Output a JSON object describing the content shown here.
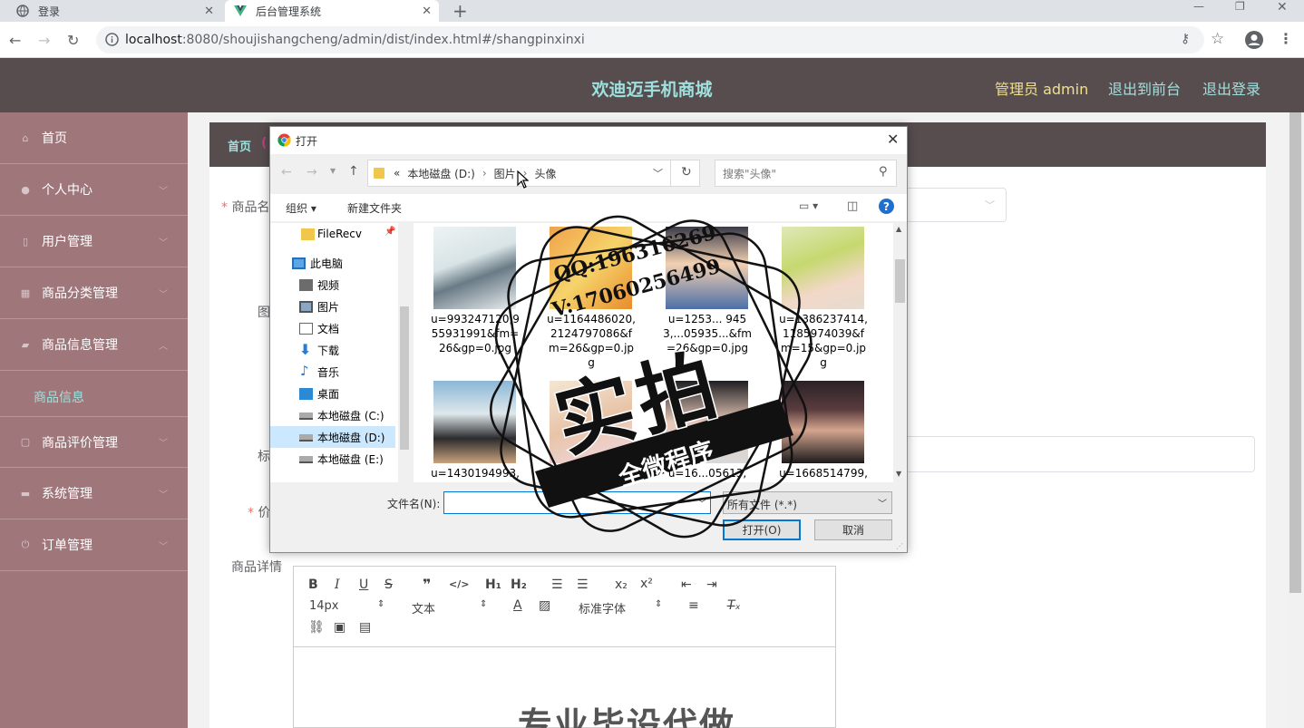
{
  "browser": {
    "tabs": [
      {
        "title": "登录",
        "active": false
      },
      {
        "title": "后台管理系统",
        "active": true
      }
    ],
    "new_tab": "+",
    "url_host": "localhost",
    "url_rest": ":8080/shoujishangcheng/admin/dist/index.html#/shangpinxinxi"
  },
  "app": {
    "title": "欢迪迈手机商城",
    "admin_label": "管理员 admin",
    "to_front": "退出到前台",
    "logout": "退出登录",
    "colors": {
      "header": "#574d4f",
      "sidebar": "#9f777b",
      "title": "#9fe0dd",
      "accent_link": "#f0e08b",
      "active_menu": "#9fe0dd"
    }
  },
  "sidebar": {
    "items": [
      {
        "label": "首页",
        "icon": "home-icon"
      },
      {
        "label": "个人中心",
        "icon": "user-icon"
      },
      {
        "label": "用户管理",
        "icon": "phone-icon"
      },
      {
        "label": "商品分类管理",
        "icon": "grid-icon"
      },
      {
        "label": "商品信息管理",
        "icon": "bag-icon"
      },
      {
        "label": "商品评价管理",
        "icon": "chat-icon"
      },
      {
        "label": "系统管理",
        "icon": "monitor-icon"
      },
      {
        "label": "订单管理",
        "icon": "power-icon"
      }
    ],
    "sub_item": "商品信息"
  },
  "breadcrumb": {
    "home": "首页",
    "paren": "("
  },
  "form": {
    "name_label": "商品名",
    "img_label": "图",
    "tag_label": "标",
    "price_label": "价",
    "detail_label": "商品详情",
    "font_size": "14px",
    "text_style": "文本",
    "font_family": "标准字体",
    "editor_content": "专业毕设代做"
  },
  "dialog": {
    "title": "打开",
    "path": [
      "«",
      "本地磁盘 (D:)",
      "›",
      "图片",
      "›",
      "头像"
    ],
    "search_placeholder": "搜索\"头像\"",
    "organize": "组织 ▾",
    "new_folder": "新建文件夹",
    "nav": [
      {
        "label": "FileRecv",
        "icon": "folder-icon"
      },
      {
        "label": "此电脑",
        "icon": "computer-icon"
      },
      {
        "label": "视频",
        "icon": "video-icon"
      },
      {
        "label": "图片",
        "icon": "pictures-icon"
      },
      {
        "label": "文档",
        "icon": "documents-icon"
      },
      {
        "label": "下载",
        "icon": "download-icon"
      },
      {
        "label": "音乐",
        "icon": "music-icon"
      },
      {
        "label": "桌面",
        "icon": "desktop-icon"
      },
      {
        "label": "本地磁盘 (C:)",
        "icon": "drive-icon"
      },
      {
        "label": "本地磁盘 (D:)",
        "icon": "drive-icon"
      },
      {
        "label": "本地磁盘 (E:)",
        "icon": "drive-icon"
      }
    ],
    "files": [
      {
        "name": "u=993247120,955931991&fm=26&gp=0.jpg"
      },
      {
        "name": "u=1164486020,2124797086&fm=26&gp=0.jpg"
      },
      {
        "name": "u=1253... 9453,...05935...&fm=26&gp=0.jpg"
      },
      {
        "name": "u=1386237414,1185974039&fm=15&gp=0.jpg"
      },
      {
        "name": "u=1430194993,"
      },
      {
        "name": "u=1614838..."
      },
      {
        "name": "u=16...05613,"
      },
      {
        "name": "u=1668514799,"
      }
    ],
    "filename_label": "文件名(N):",
    "filetype": "所有文件 (*.*)",
    "open_btn": "打开(O)",
    "cancel_btn": "取消"
  },
  "watermark": {
    "qq": "QQ:196316269",
    "phone": "V:17060256499",
    "main": "实拍",
    "sub": "全微程序"
  }
}
